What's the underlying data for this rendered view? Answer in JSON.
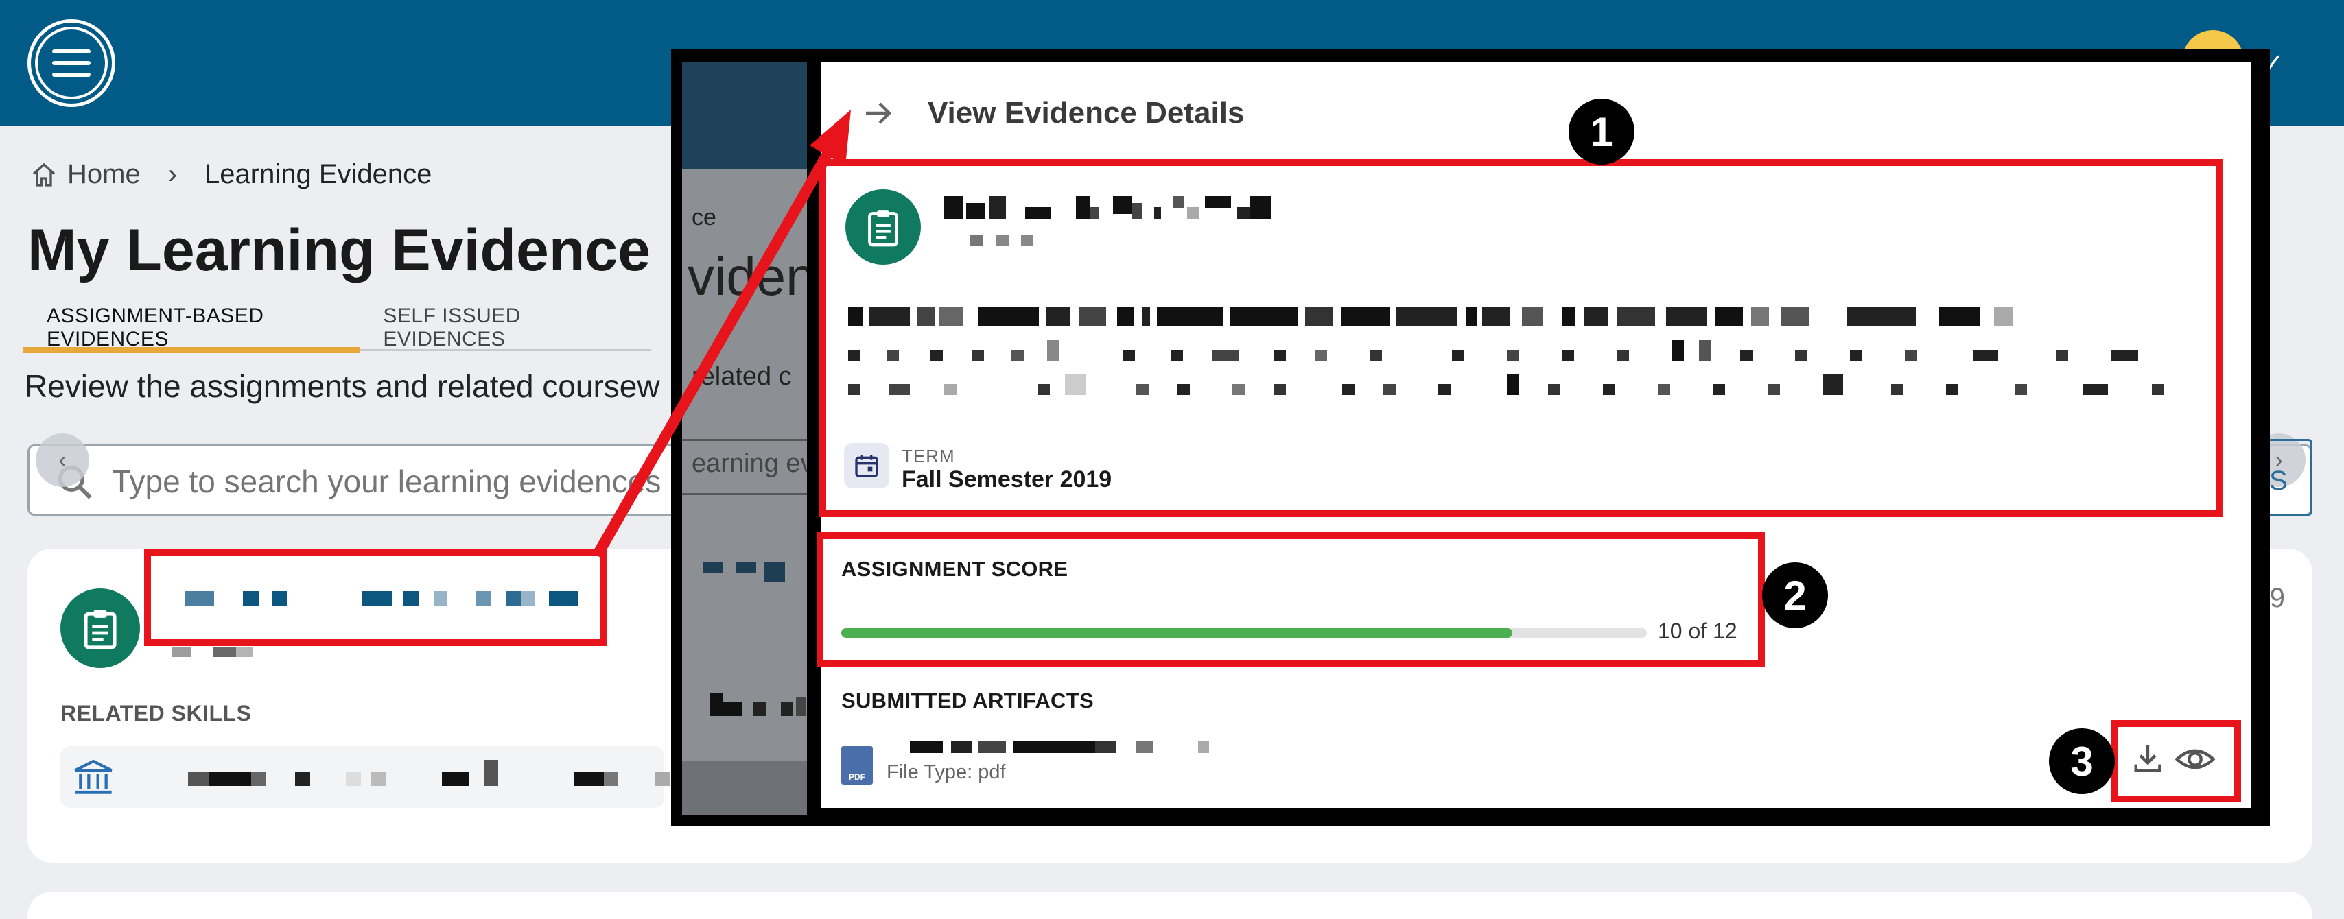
{
  "breadcrumb": {
    "home": "Home",
    "current": "Learning Evidence"
  },
  "page": {
    "title": "My Learning Evidence",
    "tabs": [
      "ASSIGNMENT-BASED EVIDENCES",
      "SELF ISSUED EVIDENCES"
    ],
    "intro": "Review the assignments and related coursew"
  },
  "search": {
    "placeholder": "Type to search your learning evidences"
  },
  "filter_button": {
    "label": "S"
  },
  "card": {
    "count_suffix": "9",
    "related_skills_label": "RELATED SKILLS"
  },
  "behind_overlay": {
    "fragment_1": "ce",
    "fragment_2": "videnc",
    "fragment_3": "related c",
    "fragment_4": "earning evi"
  },
  "panel": {
    "title": "View Evidence Details",
    "term_label": "TERM",
    "term_value": "Fall Semester 2019",
    "score_label": "ASSIGNMENT SCORE",
    "score_value": 10,
    "score_max": 12,
    "score_text": "10 of 12",
    "artifacts_label": "SUBMITTED ARTIFACTS",
    "pdf_badge": "PDF",
    "file_type": "File Type: pdf"
  },
  "annotations": {
    "callout_1": "1",
    "callout_2": "2",
    "callout_3": "3"
  },
  "colors": {
    "header_blue": "#025b87",
    "accent_green": "#0f7a5f",
    "progress_green": "#4caf50",
    "tab_underline": "#e8a73a",
    "annotation_red": "#e8141b",
    "avatar_yellow": "#f5c84a"
  },
  "icons": [
    "menu-icon",
    "home-icon",
    "chevron-right-icon",
    "search-icon",
    "clipboard-icon",
    "bank-icon",
    "arrow-right-icon",
    "calendar-icon",
    "pdf-file-icon",
    "download-icon",
    "eye-icon"
  ]
}
